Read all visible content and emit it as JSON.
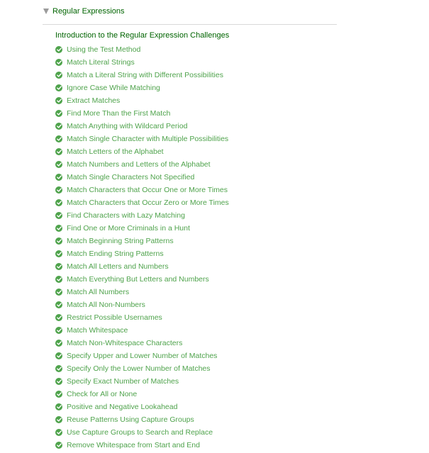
{
  "section": {
    "title": "Regular Expressions",
    "icon": "triangle-down-icon"
  },
  "intro": {
    "label": "Introduction to the Regular Expression Challenges"
  },
  "lesson_icon": "check-circle-icon",
  "colors": {
    "completed": "#4fa34c",
    "link": "#006400",
    "caret": "#9b9b9b",
    "divider": "#d9d9d9"
  },
  "lessons": [
    {
      "label": "Using the Test Method"
    },
    {
      "label": "Match Literal Strings"
    },
    {
      "label": "Match a Literal String with Different Possibilities"
    },
    {
      "label": "Ignore Case While Matching"
    },
    {
      "label": "Extract Matches"
    },
    {
      "label": "Find More Than the First Match"
    },
    {
      "label": "Match Anything with Wildcard Period"
    },
    {
      "label": "Match Single Character with Multiple Possibilities"
    },
    {
      "label": "Match Letters of the Alphabet"
    },
    {
      "label": "Match Numbers and Letters of the Alphabet"
    },
    {
      "label": "Match Single Characters Not Specified"
    },
    {
      "label": "Match Characters that Occur One or More Times"
    },
    {
      "label": "Match Characters that Occur Zero or More Times"
    },
    {
      "label": "Find Characters with Lazy Matching"
    },
    {
      "label": "Find One or More Criminals in a Hunt"
    },
    {
      "label": "Match Beginning String Patterns"
    },
    {
      "label": "Match Ending String Patterns"
    },
    {
      "label": "Match All Letters and Numbers"
    },
    {
      "label": "Match Everything But Letters and Numbers"
    },
    {
      "label": "Match All Numbers"
    },
    {
      "label": "Match All Non-Numbers"
    },
    {
      "label": "Restrict Possible Usernames"
    },
    {
      "label": "Match Whitespace"
    },
    {
      "label": "Match Non-Whitespace Characters"
    },
    {
      "label": "Specify Upper and Lower Number of Matches"
    },
    {
      "label": "Specify Only the Lower Number of Matches"
    },
    {
      "label": "Specify Exact Number of Matches"
    },
    {
      "label": "Check for All or None"
    },
    {
      "label": "Positive and Negative Lookahead"
    },
    {
      "label": "Reuse Patterns Using Capture Groups"
    },
    {
      "label": "Use Capture Groups to Search and Replace"
    },
    {
      "label": "Remove Whitespace from Start and End"
    }
  ]
}
